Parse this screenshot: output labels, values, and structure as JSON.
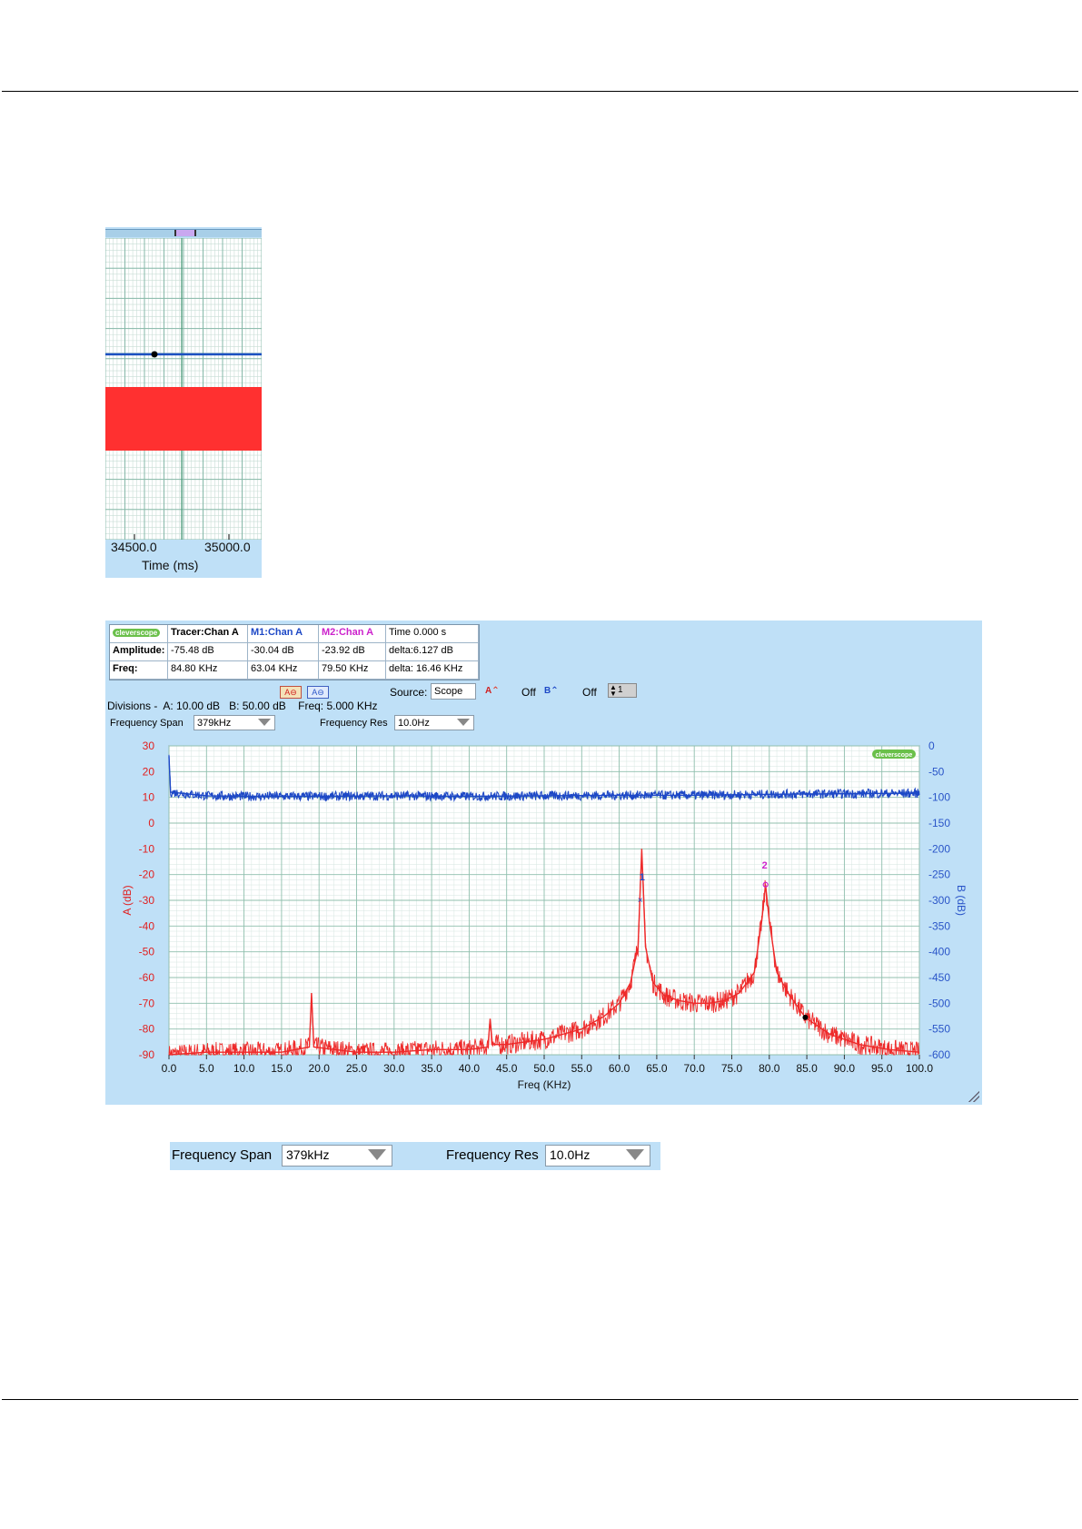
{
  "left_panel": {
    "x_ticks": [
      "34500.0",
      "35000.0"
    ],
    "x_label": "Time (ms)",
    "colors": {
      "trace_a": "#ff3030",
      "trace_b": "#1a4fc0",
      "grid_major": "#86b8a8",
      "grid_minor": "#c8ddd5",
      "panel": "#bfe0f7"
    }
  },
  "main_panel": {
    "logo_text": "cleverscope",
    "table": {
      "headers": [
        "",
        "Tracer:Chan A",
        "M1:Chan A",
        "M2:Chan A",
        "Time  0.000 s"
      ],
      "rows": [
        {
          "label": "Amplitude:",
          "values": [
            "-75.48 dB",
            "-30.04 dB",
            "-23.92 dB",
            "delta:6.127 dB"
          ]
        },
        {
          "label": "Freq:",
          "values": [
            "84.80 KHz",
            "63.04 KHz",
            "79.50 KHz",
            "delta: 16.46 KHz"
          ]
        }
      ]
    },
    "toolbar": {
      "source_label": "Source:",
      "source_value": "Scope",
      "a_off": "Off",
      "b_off": "Off",
      "spin_value": "1"
    },
    "divisions_text": "Divisions -  A: 10.00 dB   B: 50.00 dB    Freq: 5.000 KHz",
    "freq_span_label": "Frequency Span",
    "freq_span_value": "379kHz",
    "freq_res_label": "Frequency Res",
    "freq_res_value": "10.0Hz",
    "chart_logo": "cleverscope"
  },
  "chart_data": {
    "type": "line",
    "xlabel": "Freq (KHz)",
    "ylabel_left": "A (dB)",
    "ylabel_right": "B (dB)",
    "xlim": [
      0,
      100
    ],
    "ylim_left": [
      -90,
      30
    ],
    "ylim_right": [
      -600,
      0
    ],
    "x_ticks": [
      "0.0",
      "5.0",
      "10.0",
      "15.0",
      "20.0",
      "25.0",
      "30.0",
      "35.0",
      "40.0",
      "45.0",
      "50.0",
      "55.0",
      "60.0",
      "65.0",
      "70.0",
      "75.0",
      "80.0",
      "85.0",
      "90.0",
      "95.0",
      "100.0"
    ],
    "y_ticks_left": [
      "30",
      "20",
      "10",
      "0",
      "-10",
      "-20",
      "-30",
      "-40",
      "-50",
      "-60",
      "-70",
      "-80",
      "-90"
    ],
    "y_ticks_right": [
      "0",
      "-50",
      "-100",
      "-150",
      "-200",
      "-250",
      "-300",
      "-350",
      "-400",
      "-450",
      "-500",
      "-550",
      "-600"
    ],
    "series": [
      {
        "name": "Chan A",
        "color": "#ee2a2a",
        "axis": "left",
        "points": [
          [
            0,
            -90
          ],
          [
            5,
            -89
          ],
          [
            10,
            -89
          ],
          [
            15,
            -89
          ],
          [
            18.7,
            -87
          ],
          [
            19,
            -66
          ],
          [
            19.3,
            -87
          ],
          [
            25,
            -89
          ],
          [
            30,
            -89
          ],
          [
            35,
            -88
          ],
          [
            40,
            -88
          ],
          [
            42.5,
            -87
          ],
          [
            42.8,
            -76
          ],
          [
            43.1,
            -86
          ],
          [
            45,
            -86
          ],
          [
            50,
            -84
          ],
          [
            55,
            -80
          ],
          [
            58,
            -75
          ],
          [
            60,
            -70
          ],
          [
            61.5,
            -62
          ],
          [
            62.5,
            -48
          ],
          [
            63.0,
            -10
          ],
          [
            63.5,
            -48
          ],
          [
            64.5,
            -62
          ],
          [
            66,
            -67
          ],
          [
            68,
            -69
          ],
          [
            70,
            -70
          ],
          [
            72,
            -70
          ],
          [
            74,
            -69
          ],
          [
            76,
            -66
          ],
          [
            78,
            -58
          ],
          [
            79,
            -38
          ],
          [
            79.5,
            -24
          ],
          [
            80,
            -38
          ],
          [
            81,
            -58
          ],
          [
            82.5,
            -66
          ],
          [
            84.8,
            -75.5
          ],
          [
            88,
            -82
          ],
          [
            92,
            -86
          ],
          [
            96,
            -88
          ],
          [
            100,
            -89
          ]
        ]
      },
      {
        "name": "Chan B",
        "color": "#1d48c6",
        "axis": "right",
        "points": [
          [
            0,
            -20
          ],
          [
            0.2,
            -90
          ],
          [
            5,
            -97
          ],
          [
            10,
            -98
          ],
          [
            20,
            -98
          ],
          [
            30,
            -97
          ],
          [
            40,
            -98
          ],
          [
            50,
            -97
          ],
          [
            60,
            -96
          ],
          [
            70,
            -96
          ],
          [
            80,
            -94
          ],
          [
            90,
            -93
          ],
          [
            100,
            -92
          ]
        ]
      }
    ],
    "markers": [
      {
        "label": "1",
        "x": 63.04,
        "y": -30.04,
        "color": "#1d48c6"
      },
      {
        "label": "2",
        "x": 79.5,
        "y": -23.92,
        "color": "#cc22cc"
      },
      {
        "label": "tracer",
        "x": 84.8,
        "y": -75.48,
        "color": "#000000"
      }
    ]
  },
  "bottom_strip": {
    "freq_span_label": "Frequency Span",
    "freq_span_value": "379kHz",
    "freq_res_label": "Frequency Res",
    "freq_res_value": "10.0Hz"
  }
}
